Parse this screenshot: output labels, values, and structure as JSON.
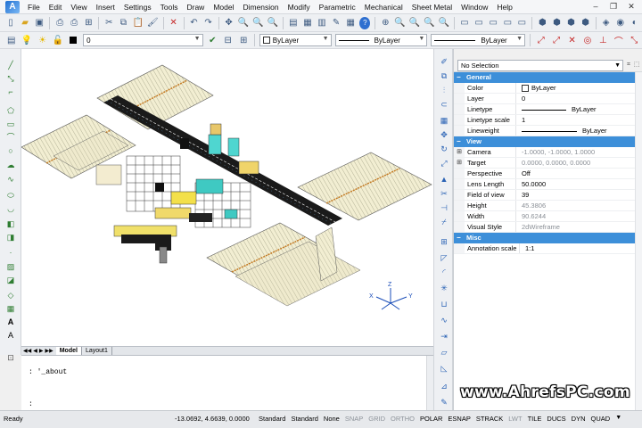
{
  "menu": [
    "File",
    "Edit",
    "View",
    "Insert",
    "Settings",
    "Tools",
    "Draw",
    "Model",
    "Dimension",
    "Modify",
    "Parametric",
    "Mechanical",
    "Sheet Metal",
    "Window",
    "Help"
  ],
  "toolbar2": {
    "layer_value": "0",
    "color_value": "ByLayer",
    "linetype_value": "ByLayer",
    "lineweight_value": "ByLayer"
  },
  "layout_tabs": {
    "model": "Model",
    "layout1": "Layout1"
  },
  "command": {
    "history_line": ": '_about",
    "prompt": ":"
  },
  "properties": {
    "selection": "No Selection",
    "general": {
      "title": "General",
      "rows": [
        {
          "name": "Color",
          "value": "ByLayer"
        },
        {
          "name": "Layer",
          "value": "0"
        },
        {
          "name": "Linetype",
          "value": "ByLayer"
        },
        {
          "name": "Linetype scale",
          "value": "1"
        },
        {
          "name": "Lineweight",
          "value": "ByLayer"
        }
      ]
    },
    "view": {
      "title": "View",
      "rows": [
        {
          "name": "Camera",
          "value": "-1.0000, -1.0000, 1.0000"
        },
        {
          "name": "Target",
          "value": "0.0000, 0.0000, 0.0000"
        },
        {
          "name": "Perspective",
          "value": "Off"
        },
        {
          "name": "Lens Length",
          "value": "50.0000"
        },
        {
          "name": "Field of view",
          "value": "39"
        },
        {
          "name": "Height",
          "value": "45.3806"
        },
        {
          "name": "Width",
          "value": "90.6244"
        },
        {
          "name": "Visual Style",
          "value": "2dWireframe"
        }
      ]
    },
    "misc": {
      "title": "Misc",
      "rows": [
        {
          "name": "Annotation scale",
          "value": "1:1"
        }
      ]
    }
  },
  "watermark": "www.AhrefsPC.com",
  "status": {
    "ready": "Ready",
    "coordinates": "-13.0692, 4.6639, 0.0000",
    "items": [
      "Standard",
      "Standard",
      "None",
      "SNAP",
      "GRID",
      "ORTHO",
      "POLAR",
      "ESNAP",
      "STRACK",
      "LWT",
      "TILE",
      "DUCS",
      "DYN",
      "QUAD"
    ]
  },
  "ucs_labels": {
    "x": "X",
    "y": "Y",
    "z": "Z"
  }
}
